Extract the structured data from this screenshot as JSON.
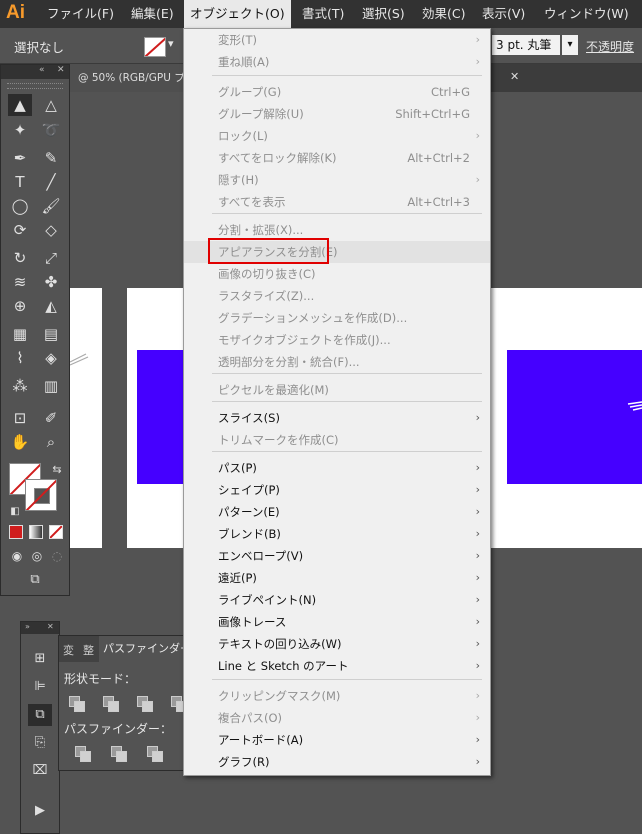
{
  "menubar": {
    "logo": "Ai",
    "items": [
      "ファイル(F)",
      "編集(E)",
      "オブジェクト(O)",
      "書式(T)",
      "選択(S)",
      "効果(C)",
      "表示(V)",
      "ウィンドウ(W)"
    ]
  },
  "control_bar": {
    "selection": "選択なし",
    "stroke_value": "3 pt. 丸筆",
    "opacity_label": "不透明度"
  },
  "document_tab": {
    "label": "@ 50% (RGB/GPU プ",
    "close": "✕"
  },
  "colors": {
    "accent_blue": "#4500ff",
    "highlight_red": "#e00000",
    "logo_orange": "#f79a2b"
  },
  "menu": {
    "items": [
      {
        "label": "変形(T)",
        "shortcut": "",
        "submenu": true,
        "disabled": true
      },
      {
        "label": "重ね順(A)",
        "shortcut": "",
        "submenu": true,
        "disabled": true
      },
      {
        "label": "グループ(G)",
        "shortcut": "Ctrl+G",
        "submenu": false,
        "disabled": true
      },
      {
        "label": "グループ解除(U)",
        "shortcut": "Shift+Ctrl+G",
        "submenu": false,
        "disabled": true
      },
      {
        "label": "ロック(L)",
        "shortcut": "",
        "submenu": true,
        "disabled": true
      },
      {
        "label": "すべてをロック解除(K)",
        "shortcut": "Alt+Ctrl+2",
        "submenu": false,
        "disabled": true
      },
      {
        "label": "隠す(H)",
        "shortcut": "",
        "submenu": true,
        "disabled": true
      },
      {
        "label": "すべてを表示",
        "shortcut": "Alt+Ctrl+3",
        "submenu": false,
        "disabled": true
      },
      {
        "label": "分割・拡張(X)...",
        "shortcut": "",
        "submenu": false,
        "disabled": true
      },
      {
        "label": "アピアランスを分割(E)",
        "shortcut": "",
        "submenu": false,
        "disabled": true
      },
      {
        "label": "画像の切り抜き(C)",
        "shortcut": "",
        "submenu": false,
        "disabled": true
      },
      {
        "label": "ラスタライズ(Z)...",
        "shortcut": "",
        "submenu": false,
        "disabled": true
      },
      {
        "label": "グラデーションメッシュを作成(D)...",
        "shortcut": "",
        "submenu": false,
        "disabled": true
      },
      {
        "label": "モザイクオブジェクトを作成(J)...",
        "shortcut": "",
        "submenu": false,
        "disabled": true
      },
      {
        "label": "透明部分を分割・統合(F)...",
        "shortcut": "",
        "submenu": false,
        "disabled": true
      },
      {
        "label": "ピクセルを最適化(M)",
        "shortcut": "",
        "submenu": false,
        "disabled": true
      },
      {
        "label": "スライス(S)",
        "shortcut": "",
        "submenu": true,
        "disabled": false
      },
      {
        "label": "トリムマークを作成(C)",
        "shortcut": "",
        "submenu": false,
        "disabled": true
      },
      {
        "label": "パス(P)",
        "shortcut": "",
        "submenu": true,
        "disabled": false
      },
      {
        "label": "シェイプ(P)",
        "shortcut": "",
        "submenu": true,
        "disabled": false
      },
      {
        "label": "パターン(E)",
        "shortcut": "",
        "submenu": true,
        "disabled": false
      },
      {
        "label": "ブレンド(B)",
        "shortcut": "",
        "submenu": true,
        "disabled": false
      },
      {
        "label": "エンベロープ(V)",
        "shortcut": "",
        "submenu": true,
        "disabled": false
      },
      {
        "label": "遠近(P)",
        "shortcut": "",
        "submenu": true,
        "disabled": false
      },
      {
        "label": "ライブペイント(N)",
        "shortcut": "",
        "submenu": true,
        "disabled": false
      },
      {
        "label": "画像トレース",
        "shortcut": "",
        "submenu": true,
        "disabled": false
      },
      {
        "label": "テキストの回り込み(W)",
        "shortcut": "",
        "submenu": true,
        "disabled": false
      },
      {
        "label": "Line と Sketch のアート",
        "shortcut": "",
        "submenu": true,
        "disabled": false
      },
      {
        "label": "クリッピングマスク(M)",
        "shortcut": "",
        "submenu": true,
        "disabled": true
      },
      {
        "label": "複合パス(O)",
        "shortcut": "",
        "submenu": true,
        "disabled": true
      },
      {
        "label": "アートボード(A)",
        "shortcut": "",
        "submenu": true,
        "disabled": false
      },
      {
        "label": "グラフ(R)",
        "shortcut": "",
        "submenu": true,
        "disabled": false
      }
    ]
  },
  "pathfinder_panel": {
    "tab1": "変",
    "tab2": "整",
    "tab3": "パスファインダー",
    "shape_modes_label": "形状モード：",
    "pathfinders_label": "パスファインダー："
  }
}
